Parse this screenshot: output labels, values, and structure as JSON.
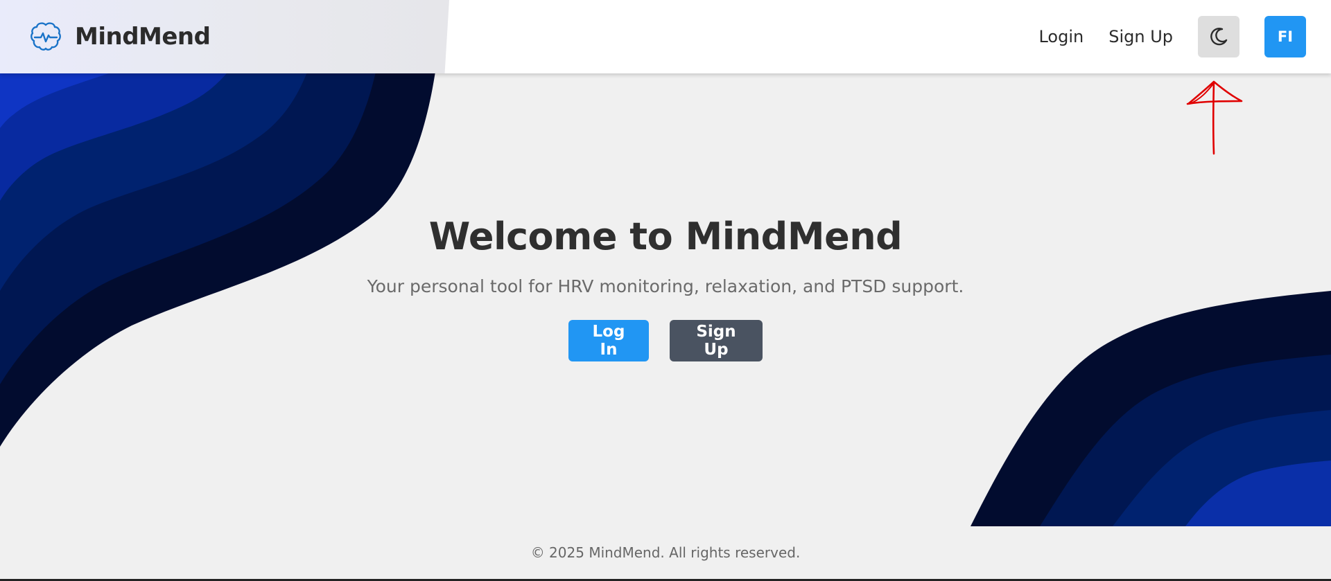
{
  "brand": {
    "name": "MindMend",
    "icon": "brain-heartbeat-icon"
  },
  "nav": {
    "login": "Login",
    "signup": "Sign Up",
    "theme_toggle_icon": "moon-icon",
    "avatar_initials": "FI"
  },
  "hero": {
    "title": "Welcome to MindMend",
    "subtitle": "Your personal tool for HRV monitoring, relaxation, and PTSD support.",
    "login_button": "Log In",
    "signup_button": "Sign Up"
  },
  "footer": {
    "text": "© 2025 MindMend. All rights reserved."
  },
  "colors": {
    "primary": "#2196f3",
    "secondary_button": "#4a5361",
    "background": "#f0f0f0",
    "wave_dark": "#020c2f",
    "wave_mid": "#001a5e",
    "wave_light": "#0033c8",
    "annotation": "#e00000"
  }
}
